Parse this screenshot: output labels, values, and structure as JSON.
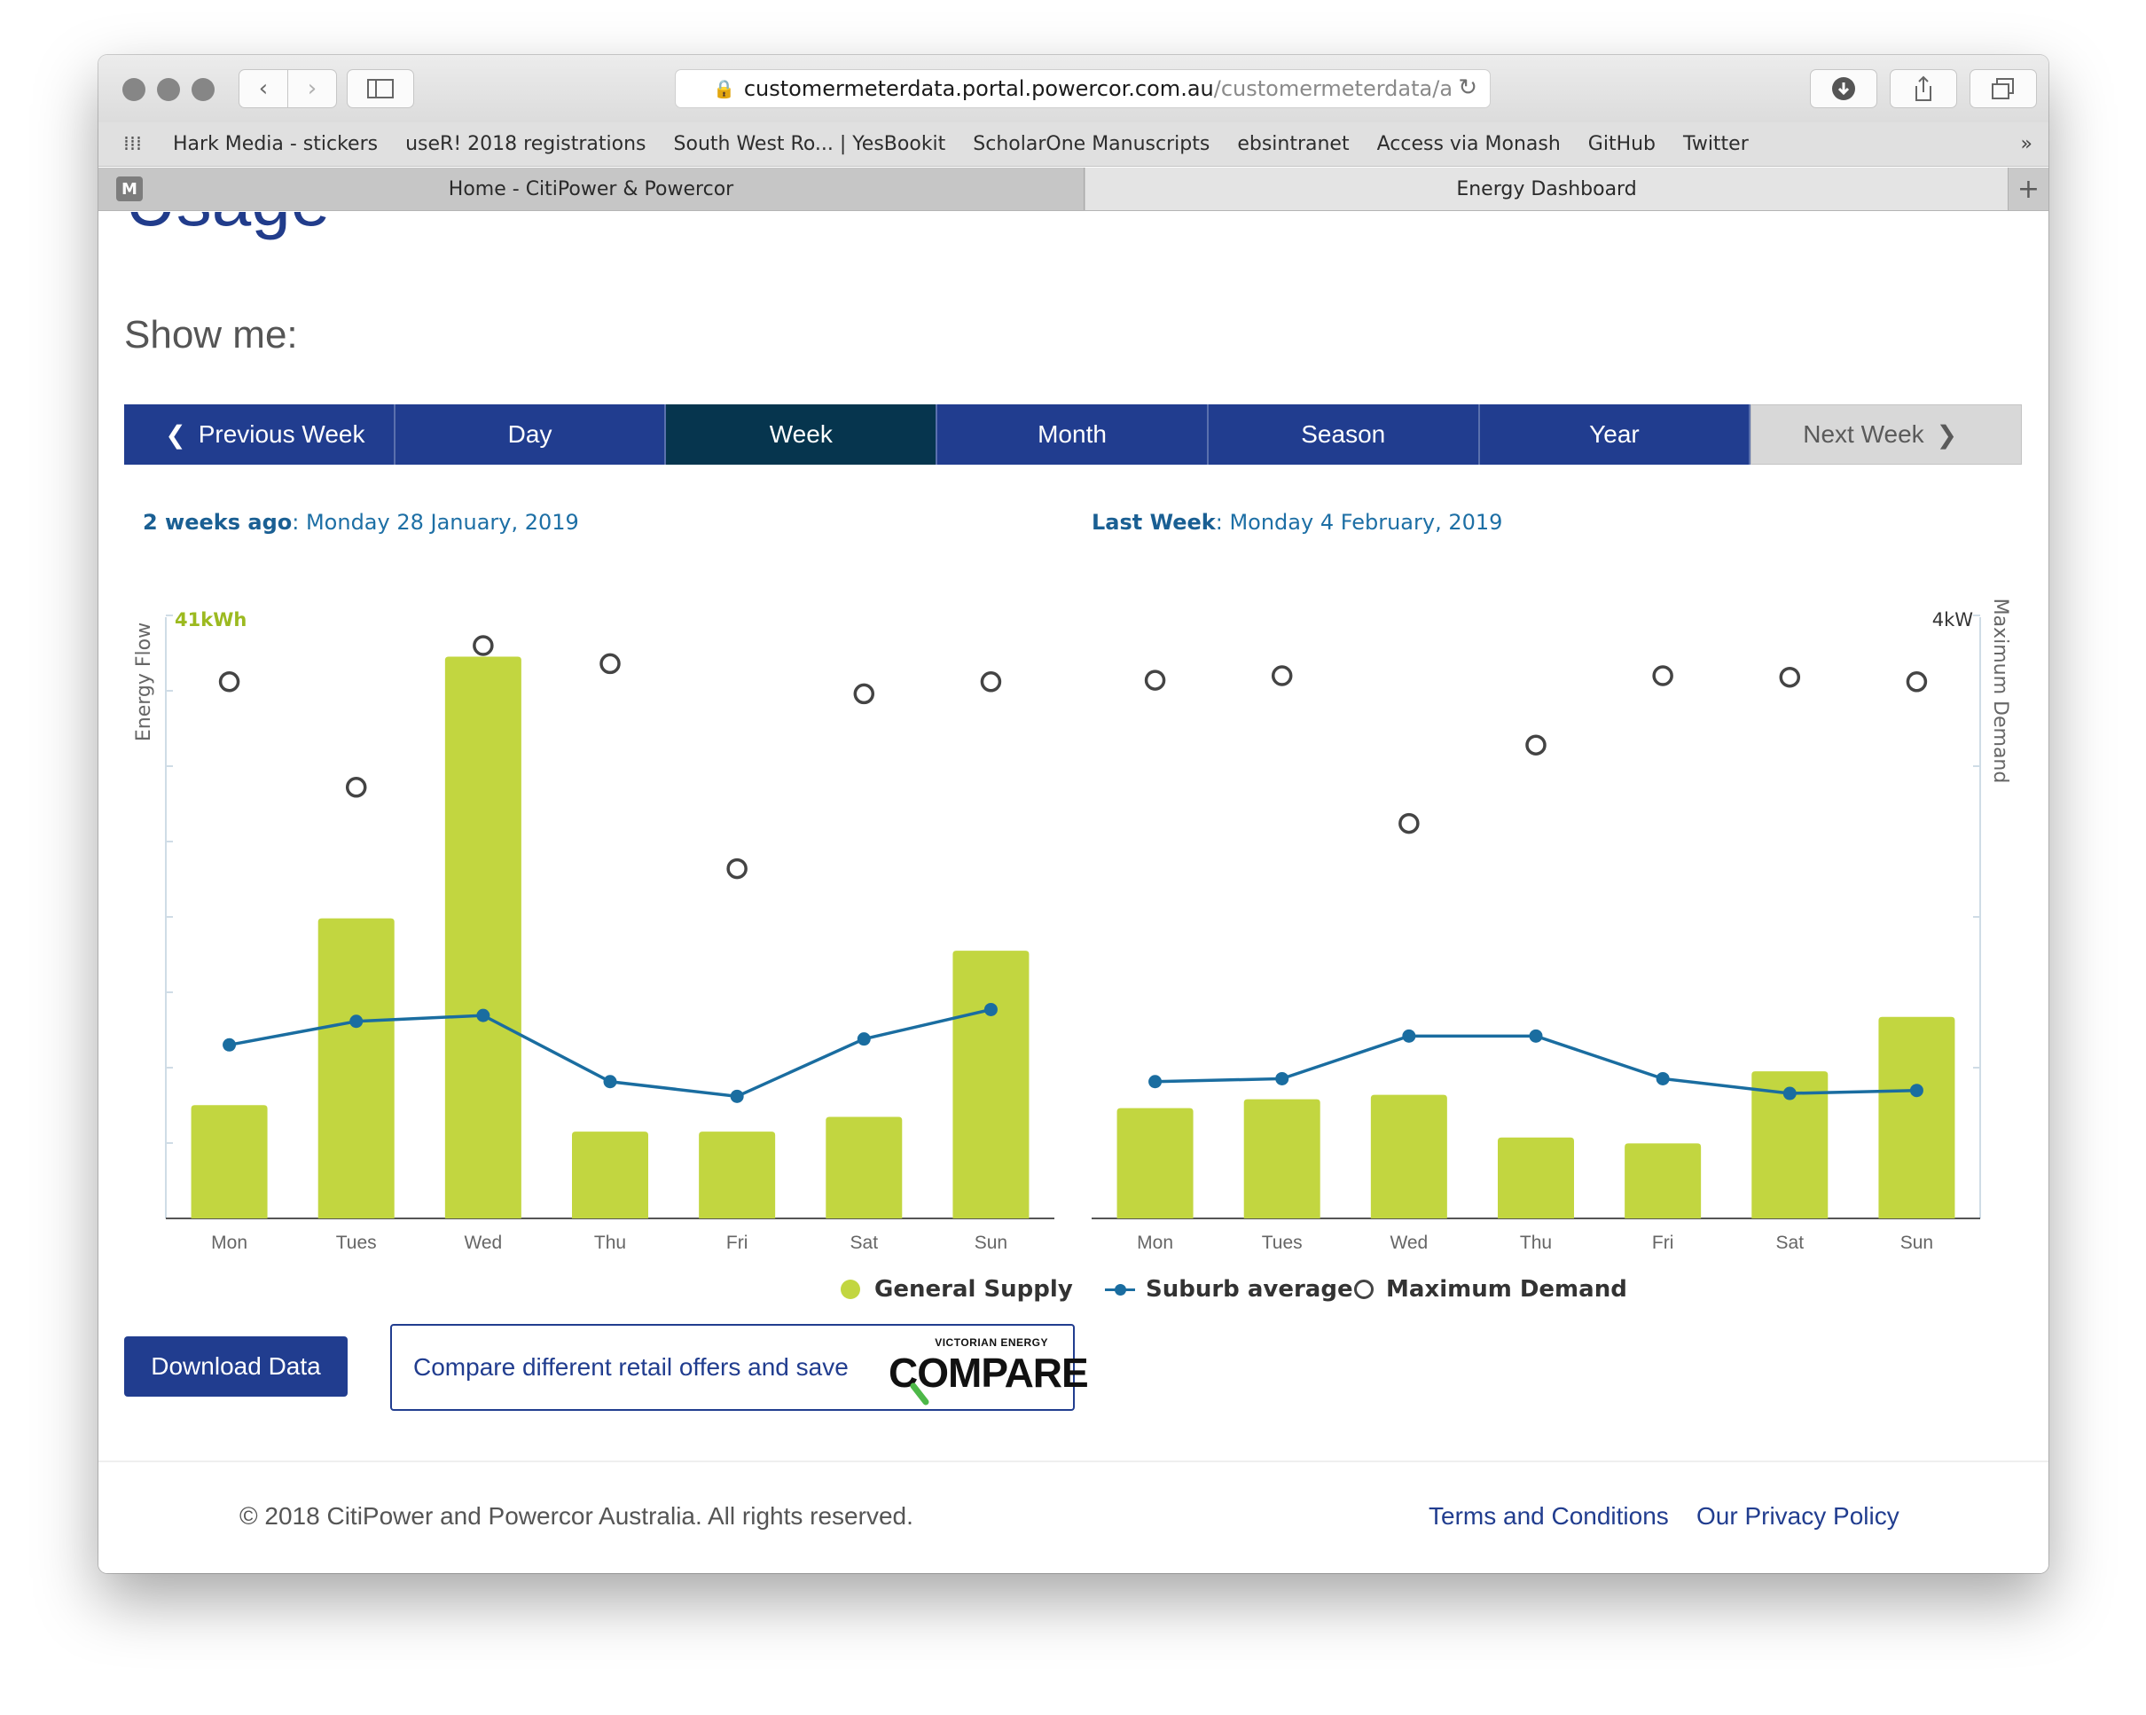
{
  "browser": {
    "url_host": "customermeterdata.portal.powercor.com.au",
    "url_path": "/customermeterdata/a",
    "bookmarks": [
      "Hark Media - stickers",
      "useR! 2018 registrations",
      "South West Ro... | YesBookit",
      "ScholarOne Manuscripts",
      "ebsintranet",
      "Access via Monash",
      "GitHub",
      "Twitter"
    ],
    "tabs": [
      "Home - CitiPower & Powercor",
      "Energy Dashboard"
    ],
    "tab_badge": "M"
  },
  "page": {
    "heading": "Usage",
    "show_me": "Show me:",
    "nav": {
      "prev": "Previous Week",
      "day": "Day",
      "week": "Week",
      "month": "Month",
      "season": "Season",
      "year": "Year",
      "next": "Next Week"
    },
    "download_label": "Download Data",
    "compare_text": "Compare different retail offers and save",
    "compare_logo_small": "VICTORIAN ENERGY",
    "compare_logo_big": "COMPARE",
    "copyright": "© 2018 CitiPower and Powercor Australia. All rights reserved.",
    "terms": "Terms and Conditions",
    "privacy": "Our Privacy Policy"
  },
  "legend": {
    "general_supply": "General Supply",
    "suburb_average": "Suburb average",
    "maximum_demand": "Maximum Demand"
  },
  "colors": {
    "navy": "#213d8f",
    "active_nav": "#06354e",
    "bar_green": "#c2d640",
    "line_blue": "#1a6da0",
    "title_blue": "#1d6fa5"
  },
  "chart_data": [
    {
      "type": "bar",
      "title_bold": "2 weeks ago",
      "title_rest": ": Monday 28 January, 2019",
      "ylabel": "Energy Flow",
      "ymax_label": "41kWh",
      "ylim": [
        0,
        41
      ],
      "categories": [
        "Mon",
        "Tues",
        "Wed",
        "Thu",
        "Fri",
        "Sat",
        "Sun"
      ],
      "series": [
        {
          "name": "General Supply",
          "unit": "kWh",
          "values": [
            7.7,
            20.4,
            38.2,
            5.9,
            5.9,
            6.9,
            18.2
          ]
        },
        {
          "name": "Suburb average",
          "unit": "kWh",
          "values": [
            11.8,
            13.4,
            13.8,
            9.3,
            8.3,
            12.2,
            14.2
          ]
        },
        {
          "name": "Maximum Demand",
          "unit": "kW",
          "y2lim": [
            0,
            4
          ],
          "values": [
            3.56,
            2.86,
            3.8,
            3.68,
            2.32,
            3.48,
            3.56
          ]
        }
      ]
    },
    {
      "type": "bar",
      "title_bold": "Last Week",
      "title_rest": ": Monday 4 February, 2019",
      "ylabel": "Maximum Demand",
      "ymax_label": "4kW",
      "ylim": [
        0,
        41
      ],
      "categories": [
        "Mon",
        "Tues",
        "Wed",
        "Thu",
        "Fri",
        "Sat",
        "Sun"
      ],
      "series": [
        {
          "name": "General Supply",
          "unit": "kWh",
          "values": [
            7.5,
            8.1,
            8.4,
            5.5,
            5.1,
            10.0,
            13.7
          ]
        },
        {
          "name": "Suburb average",
          "unit": "kWh",
          "values": [
            9.3,
            9.5,
            12.4,
            12.4,
            9.5,
            8.5,
            8.7
          ]
        },
        {
          "name": "Maximum Demand",
          "unit": "kW",
          "y2lim": [
            0,
            4
          ],
          "values": [
            3.57,
            3.6,
            2.62,
            3.14,
            3.6,
            3.59,
            3.56
          ]
        }
      ]
    }
  ]
}
